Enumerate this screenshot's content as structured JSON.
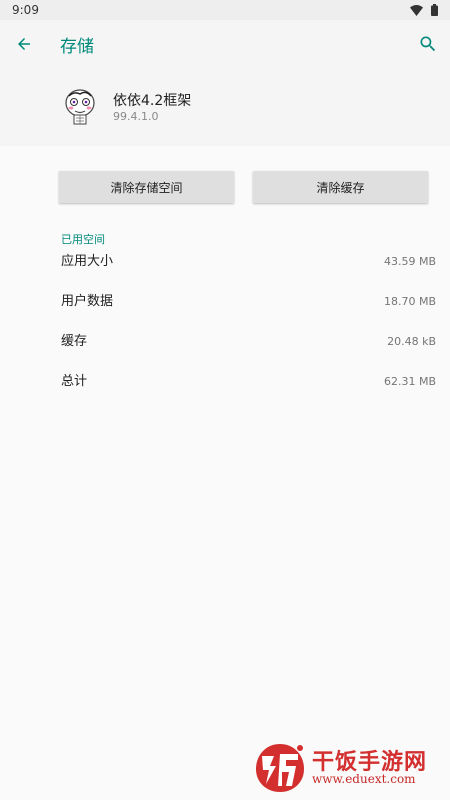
{
  "status_bar": {
    "time": "9:09"
  },
  "app_bar": {
    "title": "存储"
  },
  "app": {
    "name": "依依4.2框架",
    "version": "99.4.1.0"
  },
  "buttons": {
    "clear_storage": "清除存储空间",
    "clear_cache": "清除缓存"
  },
  "section": {
    "label": "已用空间"
  },
  "rows": [
    {
      "label": "应用大小",
      "value": "43.59 MB"
    },
    {
      "label": "用户数据",
      "value": "18.70 MB"
    },
    {
      "label": "缓存",
      "value": "20.48 kB"
    },
    {
      "label": "总计",
      "value": "62.31 MB"
    }
  ],
  "watermark": {
    "title": "干饭手游网",
    "url": "www.eduext.com"
  },
  "colors": {
    "accent": "#00897b",
    "watermark": "#d32f2f"
  }
}
